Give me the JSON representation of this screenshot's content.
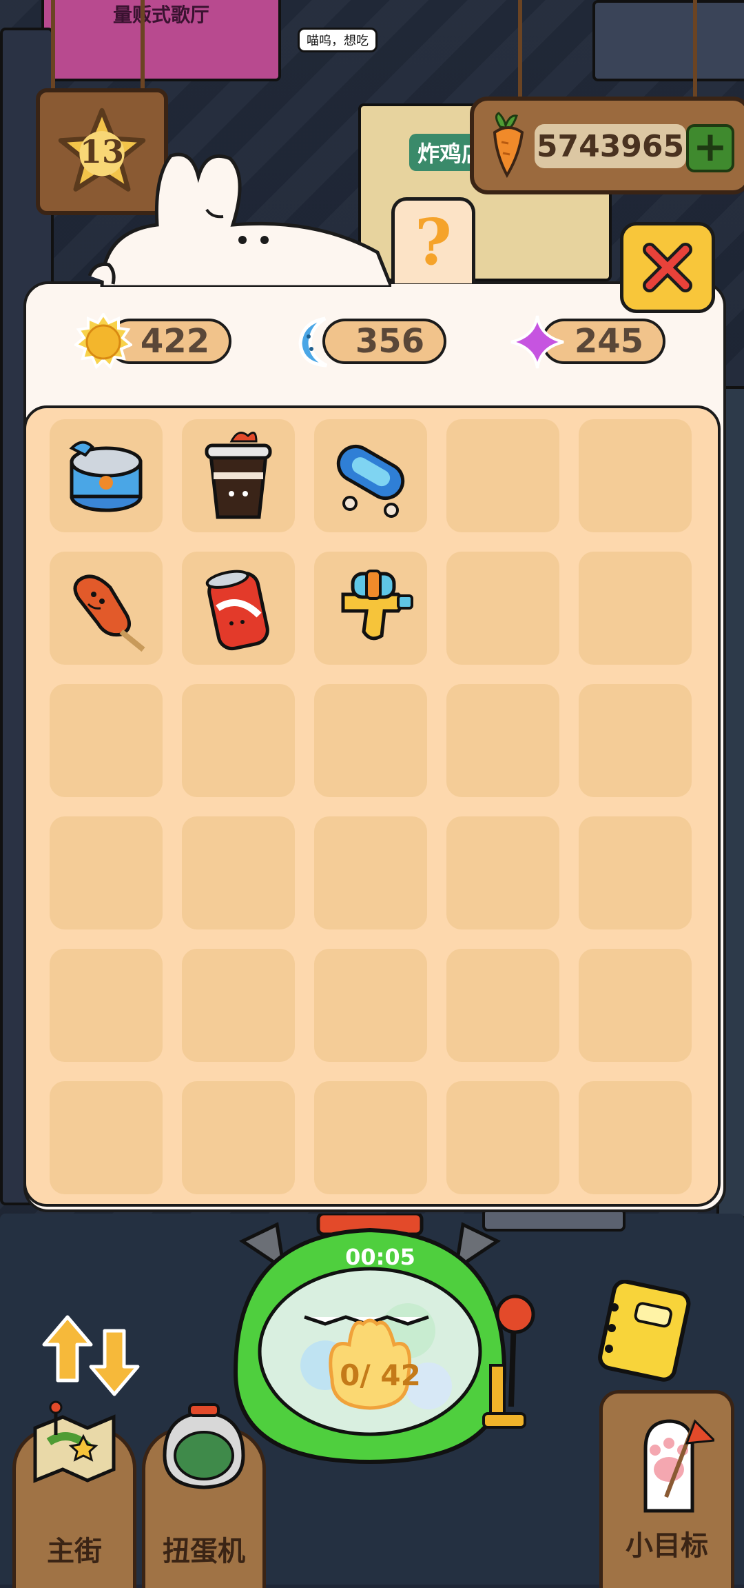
{
  "level": "13",
  "carrots": {
    "value": "5743965",
    "add_label": "+"
  },
  "resources": [
    {
      "name": "sun",
      "value": "422"
    },
    {
      "name": "moon",
      "value": "356"
    },
    {
      "name": "star",
      "value": "245"
    }
  ],
  "help_label": "?",
  "inventory": [
    {
      "item": "canned-fish-icon"
    },
    {
      "item": "iced-coffee-icon"
    },
    {
      "item": "skateboard-icon"
    },
    {
      "item": ""
    },
    {
      "item": ""
    },
    {
      "item": "corn-dog-icon"
    },
    {
      "item": "cola-can-icon"
    },
    {
      "item": "water-gun-icon"
    }
  ],
  "gacha": {
    "timer": "00:05",
    "progress": "0/ 42"
  },
  "bottom_nav": [
    {
      "label": "主街",
      "icon": "map-icon"
    },
    {
      "label": "扭蛋机",
      "icon": "gacha-machine-icon"
    },
    {
      "label": "小目标",
      "icon": "paw-flag-icon"
    }
  ],
  "background": {
    "restaurant_sign": "量贩式歌厅",
    "shop_sign": "炸鸡店",
    "bubble": "喵呜，想吃"
  }
}
